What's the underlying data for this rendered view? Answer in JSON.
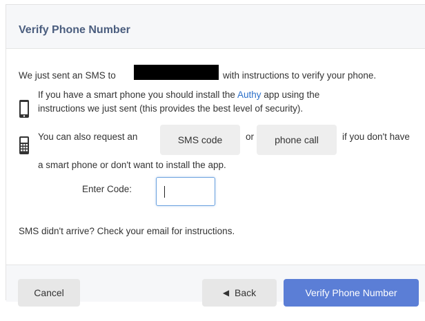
{
  "dialog": {
    "title": "Verify Phone Number"
  },
  "message": {
    "sent_prefix": "We just sent an SMS to",
    "sent_suffix": "with instructions to verify your phone.",
    "smartphone_line1_prefix": "If you have a smart phone you should install the",
    "authy_link": "Authy",
    "smartphone_line1_suffix": "app using the",
    "smartphone_line2": "instructions we just sent (this provides the best level of security).",
    "request_prefix": "You can also request an",
    "or_text": "or",
    "request_suffix": "if you don't have",
    "request_line2": "a smart phone or don't want to install the app."
  },
  "actions": {
    "sms_code_label": "SMS code",
    "phone_call_label": "phone call"
  },
  "code_entry": {
    "label": "Enter Code:",
    "value": ""
  },
  "help_text": "SMS didn't arrive? Check your email for instructions.",
  "footer": {
    "cancel_label": "Cancel",
    "back_label": "Back",
    "verify_label": "Verify Phone Number"
  },
  "colors": {
    "title": "#4a5d7e",
    "link": "#2a6fc9",
    "primary_button": "#5b7ed6",
    "header_bg": "#f6f7f9"
  },
  "icons": {
    "smartphone": "mobile-phone-icon",
    "basic_phone": "keypad-phone-icon",
    "back": "arrow-left-icon"
  }
}
